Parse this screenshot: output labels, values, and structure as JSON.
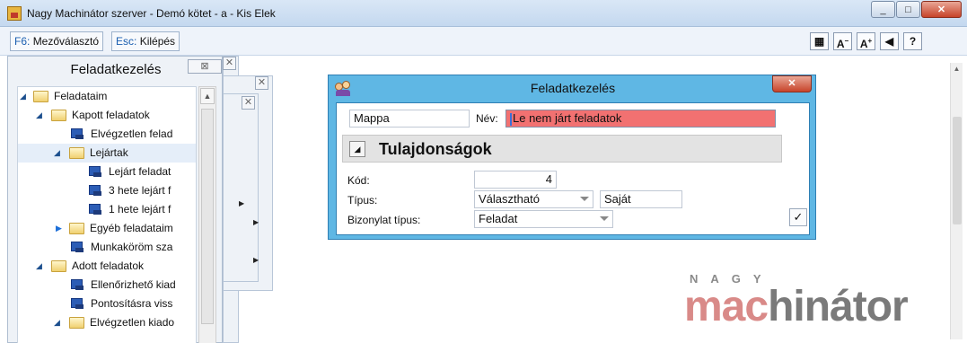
{
  "window": {
    "title": "Nagy Machinátor szerver - Demó kötet - a - Kis Elek",
    "min": "_",
    "max": "□",
    "close": "✕"
  },
  "toolbar": {
    "f6_key": "F6:",
    "f6_label": "Mezőválasztó",
    "esc_key": "Esc:",
    "esc_label": "Kilépés",
    "icons": {
      "grid": "▦",
      "font_smaller": "A",
      "font_larger": "A",
      "back": "◀",
      "help": "?"
    }
  },
  "left_panel": {
    "title": "Feladatkezelés",
    "close": "⊠",
    "tree": [
      {
        "label": "Feladataim",
        "type": "folder",
        "level": 0,
        "expanded": true
      },
      {
        "label": "Kapott feladatok",
        "type": "folder",
        "level": 1,
        "expanded": true
      },
      {
        "label": "Elvégzetlen felad",
        "type": "task",
        "level": 3
      },
      {
        "label": "Lejártak",
        "type": "folder",
        "level": 2,
        "expanded": true,
        "selected": true
      },
      {
        "label": "Lejárt feladat",
        "type": "task",
        "level": 4
      },
      {
        "label": "3 hete lejárt f",
        "type": "task",
        "level": 4
      },
      {
        "label": "1 hete lejárt f",
        "type": "task",
        "level": 4
      },
      {
        "label": "Egyéb feladataim",
        "type": "folder",
        "level": 2,
        "expanded": false
      },
      {
        "label": "Munkaköröm sza",
        "type": "task",
        "level": 3
      },
      {
        "label": "Adott feladatok",
        "type": "folder",
        "level": 1,
        "expanded": true
      },
      {
        "label": "Ellenőrizhető kiad",
        "type": "task",
        "level": 3
      },
      {
        "label": "Pontosításra viss",
        "type": "task",
        "level": 3
      },
      {
        "label": "Elvégzetlen kiado",
        "type": "folder",
        "level": 2,
        "expanded": true
      }
    ]
  },
  "dialog": {
    "title": "Feladatkezelés",
    "close": "✕",
    "mappa_value": "Mappa",
    "nev_label": "Név:",
    "nev_value": "Le nem járt feladatok",
    "section_title": "Tulajdonságok",
    "kod_label": "Kód:",
    "kod_value": "4",
    "tipus_label": "Típus:",
    "tipus_value": "Választható",
    "tipus_extra": "Saját",
    "bizonylat_label": "Bizonylat típus:",
    "bizonylat_value": "Feladat",
    "ok": "✓"
  },
  "logo": {
    "top": "NAGY",
    "part1": "mac",
    "part2": "hinátor"
  }
}
